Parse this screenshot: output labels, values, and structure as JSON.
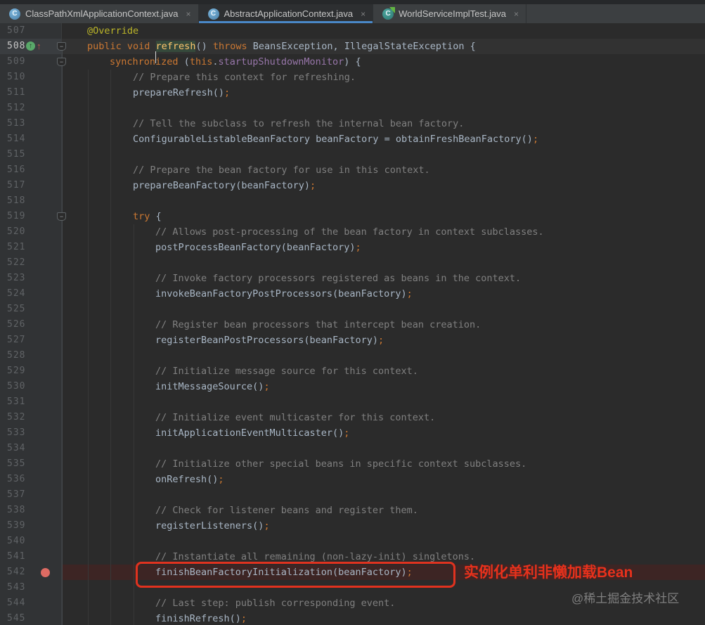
{
  "tabs": [
    {
      "label": "ClassPathXmlApplicationContext.java",
      "icon": "java-class",
      "icon_letter": "C",
      "active": false,
      "close_label": "×"
    },
    {
      "label": "AbstractApplicationContext.java",
      "icon": "java-class",
      "icon_letter": "C",
      "active": true,
      "close_label": "×"
    },
    {
      "label": "WorldServiceImplTest.java",
      "icon": "java-test-class",
      "icon_letter": "C",
      "active": false,
      "close_label": "×"
    }
  ],
  "annotations": {
    "highlight_note": "实例化单利非懒加载Bean",
    "watermark": "@稀土掘金技术社区"
  },
  "colors": {
    "keyword": "#cc7832",
    "annotation": "#bbb529",
    "comment": "#808080",
    "plain": "#a9b7c6",
    "field": "#9876aa",
    "method_decl": "#ffc66d",
    "editor_bg": "#2b2b2b",
    "gutter_bg": "#313335",
    "line_number": "#606366",
    "current_line_bg": "#323232",
    "breakpoint_line_bg": "#3d2524",
    "breakpoint_dot": "#dd6b63",
    "highlight_red": "#e0321f",
    "active_tab_underline": "#4a88c7"
  },
  "editor": {
    "override_marker_glyph": "↑",
    "nav_arrow_glyph": "↑",
    "fold_marker_glyph": "−",
    "lines": [
      {
        "n": 507,
        "ind": 1,
        "seg": [
          [
            "@Override",
            "ann"
          ]
        ]
      },
      {
        "n": 508,
        "ind": 1,
        "current": true,
        "override": true,
        "fold": true,
        "seg": [
          [
            "public void ",
            "kw"
          ],
          [
            "",
            "caret"
          ],
          [
            "refresh",
            "msel"
          ],
          [
            "() ",
            "tx"
          ],
          [
            "throws",
            "kw"
          ],
          [
            " BeansException, IllegalStateException {",
            "tx"
          ]
        ]
      },
      {
        "n": 509,
        "ind": 2,
        "fold": true,
        "seg": [
          [
            "synchronized ",
            "kw"
          ],
          [
            "(",
            "tx"
          ],
          [
            "this",
            "kw"
          ],
          [
            ".",
            "tx"
          ],
          [
            "startupShutdownMonitor",
            "fld"
          ],
          [
            ") {",
            "tx"
          ]
        ]
      },
      {
        "n": 510,
        "ind": 3,
        "seg": [
          [
            "// Prepare this context for refreshing.",
            "cm"
          ]
        ]
      },
      {
        "n": 511,
        "ind": 3,
        "seg": [
          [
            "prepareRefresh()",
            "tx"
          ],
          [
            ";",
            "kw"
          ]
        ]
      },
      {
        "n": 512,
        "ind": 0,
        "seg": []
      },
      {
        "n": 513,
        "ind": 3,
        "seg": [
          [
            "// Tell the subclass to refresh the internal bean factory.",
            "cm"
          ]
        ]
      },
      {
        "n": 514,
        "ind": 3,
        "seg": [
          [
            "ConfigurableListableBeanFactory beanFactory = obtainFreshBeanFactory()",
            "tx"
          ],
          [
            ";",
            "kw"
          ]
        ]
      },
      {
        "n": 515,
        "ind": 0,
        "seg": []
      },
      {
        "n": 516,
        "ind": 3,
        "seg": [
          [
            "// Prepare the bean factory for use in this context.",
            "cm"
          ]
        ]
      },
      {
        "n": 517,
        "ind": 3,
        "seg": [
          [
            "prepareBeanFactory(beanFactory)",
            "tx"
          ],
          [
            ";",
            "kw"
          ]
        ]
      },
      {
        "n": 518,
        "ind": 0,
        "seg": []
      },
      {
        "n": 519,
        "ind": 3,
        "fold": true,
        "seg": [
          [
            "try",
            "kw"
          ],
          [
            " {",
            "tx"
          ]
        ]
      },
      {
        "n": 520,
        "ind": 4,
        "seg": [
          [
            "// Allows post-processing of the bean factory in context subclasses.",
            "cm"
          ]
        ]
      },
      {
        "n": 521,
        "ind": 4,
        "seg": [
          [
            "postProcessBeanFactory(beanFactory)",
            "tx"
          ],
          [
            ";",
            "kw"
          ]
        ]
      },
      {
        "n": 522,
        "ind": 0,
        "seg": []
      },
      {
        "n": 523,
        "ind": 4,
        "seg": [
          [
            "// Invoke factory processors registered as beans in the context.",
            "cm"
          ]
        ]
      },
      {
        "n": 524,
        "ind": 4,
        "seg": [
          [
            "invokeBeanFactoryPostProcessors(beanFactory)",
            "tx"
          ],
          [
            ";",
            "kw"
          ]
        ]
      },
      {
        "n": 525,
        "ind": 0,
        "seg": []
      },
      {
        "n": 526,
        "ind": 4,
        "seg": [
          [
            "// Register bean processors that intercept bean creation.",
            "cm"
          ]
        ]
      },
      {
        "n": 527,
        "ind": 4,
        "seg": [
          [
            "registerBeanPostProcessors(beanFactory)",
            "tx"
          ],
          [
            ";",
            "kw"
          ]
        ]
      },
      {
        "n": 528,
        "ind": 0,
        "seg": []
      },
      {
        "n": 529,
        "ind": 4,
        "seg": [
          [
            "// Initialize message source for this context.",
            "cm"
          ]
        ]
      },
      {
        "n": 530,
        "ind": 4,
        "seg": [
          [
            "initMessageSource()",
            "tx"
          ],
          [
            ";",
            "kw"
          ]
        ]
      },
      {
        "n": 531,
        "ind": 0,
        "seg": []
      },
      {
        "n": 532,
        "ind": 4,
        "seg": [
          [
            "// Initialize event multicaster for this context.",
            "cm"
          ]
        ]
      },
      {
        "n": 533,
        "ind": 4,
        "seg": [
          [
            "initApplicationEventMulticaster()",
            "tx"
          ],
          [
            ";",
            "kw"
          ]
        ]
      },
      {
        "n": 534,
        "ind": 0,
        "seg": []
      },
      {
        "n": 535,
        "ind": 4,
        "seg": [
          [
            "// Initialize other special beans in specific context subclasses.",
            "cm"
          ]
        ]
      },
      {
        "n": 536,
        "ind": 4,
        "seg": [
          [
            "onRefresh()",
            "tx"
          ],
          [
            ";",
            "kw"
          ]
        ]
      },
      {
        "n": 537,
        "ind": 0,
        "seg": []
      },
      {
        "n": 538,
        "ind": 4,
        "seg": [
          [
            "// Check for listener beans and register them.",
            "cm"
          ]
        ]
      },
      {
        "n": 539,
        "ind": 4,
        "seg": [
          [
            "registerListeners()",
            "tx"
          ],
          [
            ";",
            "kw"
          ]
        ]
      },
      {
        "n": 540,
        "ind": 0,
        "seg": []
      },
      {
        "n": 541,
        "ind": 4,
        "seg": [
          [
            "// Instantiate all remaining (non-lazy-init) singletons.",
            "cm"
          ]
        ]
      },
      {
        "n": 542,
        "ind": 4,
        "breakpoint": true,
        "boxed": true,
        "seg": [
          [
            "finishBeanFactoryInitialization(beanFactory)",
            "tx"
          ],
          [
            ";",
            "kw"
          ]
        ]
      },
      {
        "n": 543,
        "ind": 0,
        "seg": []
      },
      {
        "n": 544,
        "ind": 4,
        "seg": [
          [
            "// Last step: publish corresponding event.",
            "cm"
          ]
        ]
      },
      {
        "n": 545,
        "ind": 4,
        "seg": [
          [
            "finishRefresh()",
            "tx"
          ],
          [
            ";",
            "kw"
          ]
        ]
      }
    ]
  }
}
